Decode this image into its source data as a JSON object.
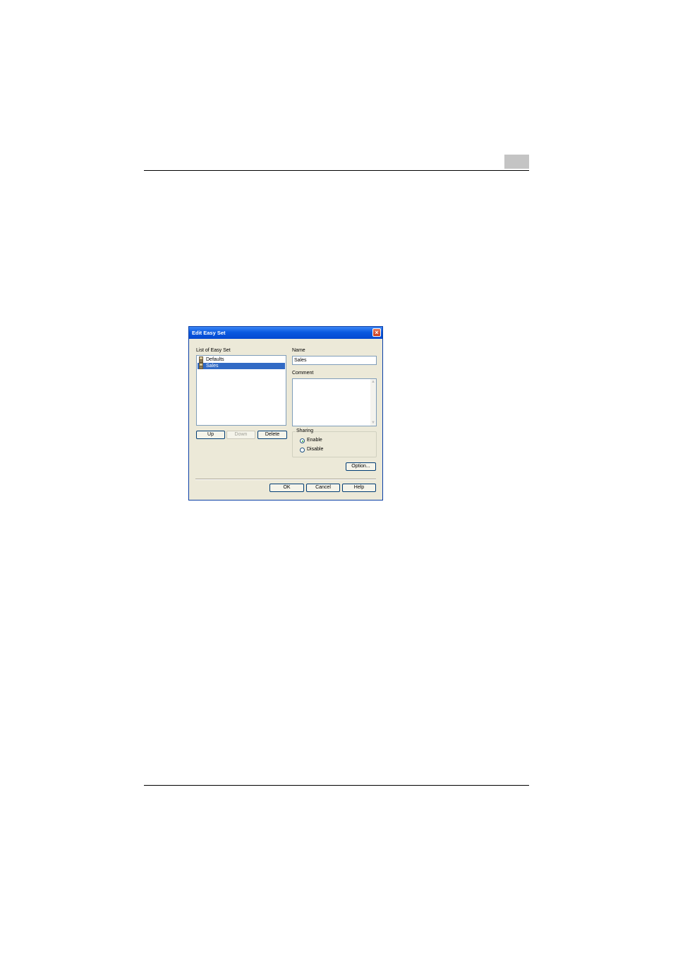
{
  "dialog": {
    "title": "Edit Easy Set",
    "list_label": "List of Easy Set",
    "list_items": [
      {
        "label": "Defaults",
        "selected": false
      },
      {
        "label": "Sales",
        "selected": true
      }
    ],
    "name_label": "Name",
    "name_value": "Sales",
    "comment_label": "Comment",
    "comment_value": "",
    "buttons": {
      "up": "Up",
      "down": "Down",
      "delete": "Delete",
      "option": "Option...",
      "ok": "OK",
      "cancel": "Cancel",
      "help": "Help"
    },
    "sharing": {
      "title": "Sharing",
      "enable": "Enable",
      "disable": "Disable",
      "selected": "enable"
    }
  }
}
